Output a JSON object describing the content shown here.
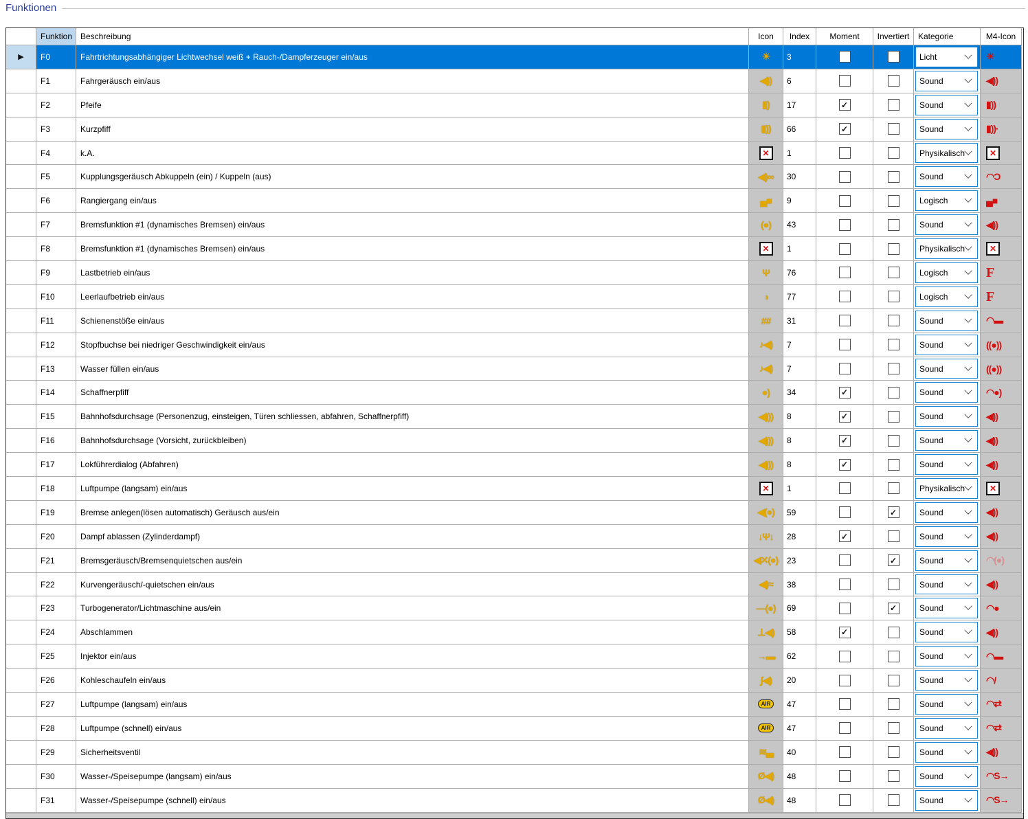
{
  "title": "Funktionen",
  "colors": {
    "selection_blue": "#0078d7",
    "selector_highlight": "#c3dcf0",
    "header_funktion_bg": "#bdd8ee",
    "icon_column_gray": "#c6c6c6",
    "dropdown_border": "#1583d5",
    "title_blue": "#2b3f9e",
    "icon_yellow": "#e3a800",
    "m4_red": "#d31111"
  },
  "table": {
    "columns": [
      {
        "key": "funktion",
        "label": "Funktion"
      },
      {
        "key": "beschreibung",
        "label": "Beschreibung"
      },
      {
        "key": "icon",
        "label": "Icon"
      },
      {
        "key": "index",
        "label": "Index"
      },
      {
        "key": "moment",
        "label": "Moment"
      },
      {
        "key": "invertiert",
        "label": "Invertiert"
      },
      {
        "key": "kategorie",
        "label": "Kategorie"
      },
      {
        "key": "m4",
        "label": "M4-Icon"
      }
    ],
    "rows": [
      {
        "funktion": "F0",
        "beschreibung": "Fahrtrichtungsabhängiger Lichtwechsel weiß + Rauch-/Dampferzeuger ein/aus",
        "icon": {
          "name": "light-sun-icon",
          "glyph": "☀",
          "kind": "yellow"
        },
        "index": "3",
        "moment": false,
        "invertiert": false,
        "kategorie": "Licht",
        "m4": {
          "name": "m4-light-icon",
          "glyph": "☀",
          "kind": "red"
        },
        "selected": true
      },
      {
        "funktion": "F1",
        "beschreibung": "Fahrgeräusch ein/aus",
        "icon": {
          "name": "speaker-waves-icon",
          "glyph": "◀))",
          "kind": "yellow"
        },
        "index": "6",
        "moment": false,
        "invertiert": false,
        "kategorie": "Sound",
        "m4": {
          "name": "m4-speaker-icon",
          "glyph": "◀))",
          "kind": "red"
        },
        "selected": false
      },
      {
        "funktion": "F2",
        "beschreibung": "Pfeife",
        "icon": {
          "name": "whistle-icon",
          "glyph": "▮)",
          "kind": "yellow"
        },
        "index": "17",
        "moment": true,
        "invertiert": false,
        "kategorie": "Sound",
        "m4": {
          "name": "m4-whistle-icon",
          "glyph": "▮))",
          "kind": "red"
        },
        "selected": false
      },
      {
        "funktion": "F3",
        "beschreibung": "Kurzpfiff",
        "icon": {
          "name": "short-whistle-icon",
          "glyph": "▮))",
          "kind": "yellow"
        },
        "index": "66",
        "moment": true,
        "invertiert": false,
        "kategorie": "Sound",
        "m4": {
          "name": "m4-short-whistle-icon",
          "glyph": "▮))·",
          "kind": "red"
        },
        "selected": false
      },
      {
        "funktion": "F4",
        "beschreibung": "k.A.",
        "icon": {
          "name": "not-assigned-x-icon",
          "glyph": "✕",
          "kind": "xbox"
        },
        "index": "1",
        "moment": false,
        "invertiert": false,
        "kategorie": "Physikalisch",
        "m4": {
          "name": "m4-x-icon",
          "glyph": "✕",
          "kind": "xbox"
        },
        "selected": false
      },
      {
        "funktion": "F5",
        "beschreibung": "Kupplungsgeräusch Abkuppeln (ein) / Kuppeln (aus)",
        "icon": {
          "name": "coupler-sound-icon",
          "glyph": "◀)∞",
          "kind": "yellow"
        },
        "index": "30",
        "moment": false,
        "invertiert": false,
        "kategorie": "Sound",
        "m4": {
          "name": "m4-coupler-waves-icon",
          "glyph": "◠Ɔ",
          "kind": "red"
        },
        "selected": false
      },
      {
        "funktion": "F6",
        "beschreibung": "Rangiergang ein/aus",
        "icon": {
          "name": "shunting-loco-icon",
          "glyph": "▄■",
          "kind": "yellow"
        },
        "index": "9",
        "moment": false,
        "invertiert": false,
        "kategorie": "Logisch",
        "m4": {
          "name": "m4-shunting-loco-icon",
          "glyph": "▄■",
          "kind": "red"
        },
        "selected": false
      },
      {
        "funktion": "F7",
        "beschreibung": "Bremsfunktion #1 (dynamisches Bremsen) ein/aus",
        "icon": {
          "name": "dynamic-brake-sound-icon",
          "glyph": "(●)",
          "kind": "yellow"
        },
        "index": "43",
        "moment": false,
        "invertiert": false,
        "kategorie": "Sound",
        "m4": {
          "name": "m4-speaker-icon",
          "glyph": "◀))",
          "kind": "red"
        },
        "selected": false
      },
      {
        "funktion": "F8",
        "beschreibung": "Bremsfunktion #1 (dynamisches Bremsen) ein/aus",
        "icon": {
          "name": "not-assigned-x-icon",
          "glyph": "✕",
          "kind": "xbox"
        },
        "index": "1",
        "moment": false,
        "invertiert": false,
        "kategorie": "Physikalisch",
        "m4": {
          "name": "m4-x-icon",
          "glyph": "✕",
          "kind": "xbox"
        },
        "selected": false
      },
      {
        "funktion": "F9",
        "beschreibung": "Lastbetrieb ein/aus",
        "icon": {
          "name": "load-operation-icon",
          "glyph": "Ψ",
          "kind": "yellow"
        },
        "index": "76",
        "moment": false,
        "invertiert": false,
        "kategorie": "Logisch",
        "m4": {
          "name": "m4-logic-f-icon",
          "glyph": "F",
          "kind": "fletter"
        },
        "selected": false
      },
      {
        "funktion": "F10",
        "beschreibung": "Leerlaufbetrieb ein/aus",
        "icon": {
          "name": "idle-gauge-icon",
          "glyph": "◑",
          "kind": "yellow"
        },
        "index": "77",
        "moment": false,
        "invertiert": false,
        "kategorie": "Logisch",
        "m4": {
          "name": "m4-logic-f-icon",
          "glyph": "F",
          "kind": "fletter"
        },
        "selected": false
      },
      {
        "funktion": "F11",
        "beschreibung": "Schienenstöße ein/aus",
        "icon": {
          "name": "rail-joints-icon",
          "glyph": "##",
          "kind": "yellow"
        },
        "index": "31",
        "moment": false,
        "invertiert": false,
        "kategorie": "Sound",
        "m4": {
          "name": "m4-rail-waves-icon",
          "glyph": "◠▬",
          "kind": "red"
        },
        "selected": false
      },
      {
        "funktion": "F12",
        "beschreibung": "Stopfbuchse bei niedriger Geschwindigkeit ein/aus",
        "icon": {
          "name": "gland-sound-icon",
          "glyph": "♪◀)",
          "kind": "yellow"
        },
        "index": "7",
        "moment": false,
        "invertiert": false,
        "kategorie": "Sound",
        "m4": {
          "name": "m4-gland-lock-icon",
          "glyph": "((●))",
          "kind": "red"
        },
        "selected": false
      },
      {
        "funktion": "F13",
        "beschreibung": "Wasser füllen ein/aus",
        "icon": {
          "name": "water-fill-sound-icon",
          "glyph": "♪◀)",
          "kind": "yellow"
        },
        "index": "7",
        "moment": false,
        "invertiert": false,
        "kategorie": "Sound",
        "m4": {
          "name": "m4-gland-lock-icon",
          "glyph": "((●))",
          "kind": "red"
        },
        "selected": false
      },
      {
        "funktion": "F14",
        "beschreibung": "Schaffnerpfiff",
        "icon": {
          "name": "conductor-whistle-icon",
          "glyph": "●)",
          "kind": "yellow"
        },
        "index": "34",
        "moment": true,
        "invertiert": false,
        "kategorie": "Sound",
        "m4": {
          "name": "m4-whistle-waves-icon",
          "glyph": "◠●)",
          "kind": "red"
        },
        "selected": false
      },
      {
        "funktion": "F15",
        "beschreibung": "Bahnhofsdurchsage (Personenzug, einsteigen, Türen schliessen, abfahren, Schaffnerpfiff)",
        "icon": {
          "name": "announcement-horn-icon",
          "glyph": "◀)))",
          "kind": "yellow"
        },
        "index": "8",
        "moment": true,
        "invertiert": false,
        "kategorie": "Sound",
        "m4": {
          "name": "m4-speaker-icon",
          "glyph": "◀))",
          "kind": "red"
        },
        "selected": false
      },
      {
        "funktion": "F16",
        "beschreibung": "Bahnhofsdurchsage (Vorsicht, zurückbleiben)",
        "icon": {
          "name": "announcement-horn-icon",
          "glyph": "◀)))",
          "kind": "yellow"
        },
        "index": "8",
        "moment": true,
        "invertiert": false,
        "kategorie": "Sound",
        "m4": {
          "name": "m4-speaker-icon",
          "glyph": "◀))",
          "kind": "red"
        },
        "selected": false
      },
      {
        "funktion": "F17",
        "beschreibung": "Lokführerdialog (Abfahren)",
        "icon": {
          "name": "announcement-horn-icon",
          "glyph": "◀)))",
          "kind": "yellow"
        },
        "index": "8",
        "moment": true,
        "invertiert": false,
        "kategorie": "Sound",
        "m4": {
          "name": "m4-speaker-icon",
          "glyph": "◀))",
          "kind": "red"
        },
        "selected": false
      },
      {
        "funktion": "F18",
        "beschreibung": "Luftpumpe (langsam) ein/aus",
        "icon": {
          "name": "not-assigned-x-icon",
          "glyph": "✕",
          "kind": "xbox"
        },
        "index": "1",
        "moment": false,
        "invertiert": false,
        "kategorie": "Physikalisch",
        "m4": {
          "name": "m4-x-icon",
          "glyph": "✕",
          "kind": "xbox"
        },
        "selected": false
      },
      {
        "funktion": "F19",
        "beschreibung": "Bremse anlegen(lösen automatisch) Geräusch aus/ein",
        "icon": {
          "name": "brake-sound-icon",
          "glyph": "◀(●)",
          "kind": "yellow"
        },
        "index": "59",
        "moment": false,
        "invertiert": true,
        "kategorie": "Sound",
        "m4": {
          "name": "m4-speaker-icon",
          "glyph": "◀))",
          "kind": "red"
        },
        "selected": false
      },
      {
        "funktion": "F20",
        "beschreibung": "Dampf ablassen (Zylinderdampf)",
        "icon": {
          "name": "cylinder-steam-icon",
          "glyph": "↓Ψ↓",
          "kind": "yellow"
        },
        "index": "28",
        "moment": true,
        "invertiert": false,
        "kategorie": "Sound",
        "m4": {
          "name": "m4-speaker-icon",
          "glyph": "◀))",
          "kind": "red"
        },
        "selected": false
      },
      {
        "funktion": "F21",
        "beschreibung": "Bremsgeräusch/Bremsenquietschen aus/ein",
        "icon": {
          "name": "brake-squeal-mute-icon",
          "glyph": "◀✕(●)",
          "kind": "yellow"
        },
        "index": "23",
        "moment": false,
        "invertiert": true,
        "kategorie": "Sound",
        "m4": {
          "name": "m4-brake-squeal-icon",
          "glyph": "◠(●)",
          "kind": "reddim"
        },
        "selected": false
      },
      {
        "funktion": "F22",
        "beschreibung": "Kurvengeräusch/-quietschen ein/aus",
        "icon": {
          "name": "curve-squeal-icon",
          "glyph": "◀)≈",
          "kind": "yellow"
        },
        "index": "38",
        "moment": false,
        "invertiert": false,
        "kategorie": "Sound",
        "m4": {
          "name": "m4-speaker-icon",
          "glyph": "◀))",
          "kind": "red"
        },
        "selected": false
      },
      {
        "funktion": "F23",
        "beschreibung": "Turbogenerator/Lichtmaschine aus/ein",
        "icon": {
          "name": "turbo-generator-icon",
          "glyph": "—(●)",
          "kind": "yellow"
        },
        "index": "69",
        "moment": false,
        "invertiert": true,
        "kategorie": "Sound",
        "m4": {
          "name": "m4-generator-waves-icon",
          "glyph": "◠●",
          "kind": "red"
        },
        "selected": false
      },
      {
        "funktion": "F24",
        "beschreibung": "Abschlammen",
        "icon": {
          "name": "blowdown-speaker-icon",
          "glyph": "⊥◀)",
          "kind": "yellow"
        },
        "index": "58",
        "moment": true,
        "invertiert": false,
        "kategorie": "Sound",
        "m4": {
          "name": "m4-speaker-icon",
          "glyph": "◀))",
          "kind": "red"
        },
        "selected": false
      },
      {
        "funktion": "F25",
        "beschreibung": "Injektor ein/aus",
        "icon": {
          "name": "injector-icon",
          "glyph": "→▬",
          "kind": "yellow"
        },
        "index": "62",
        "moment": false,
        "invertiert": false,
        "kategorie": "Sound",
        "m4": {
          "name": "m4-injector-waves-icon",
          "glyph": "◠▬",
          "kind": "red"
        },
        "selected": false
      },
      {
        "funktion": "F26",
        "beschreibung": "Kohleschaufeln ein/aus",
        "icon": {
          "name": "coal-shoveling-icon",
          "glyph": "ʃ◀)",
          "kind": "yellow"
        },
        "index": "20",
        "moment": false,
        "invertiert": false,
        "kategorie": "Sound",
        "m4": {
          "name": "m4-shovel-waves-icon",
          "glyph": "◠/",
          "kind": "red"
        },
        "selected": false
      },
      {
        "funktion": "F27",
        "beschreibung": "Luftpumpe (langsam) ein/aus",
        "icon": {
          "name": "air-pump-badge-icon",
          "glyph": "AIR",
          "kind": "pill"
        },
        "index": "47",
        "moment": false,
        "invertiert": false,
        "kategorie": "Sound",
        "m4": {
          "name": "m4-air-pump-waves-icon",
          "glyph": "◠⇄",
          "kind": "red"
        },
        "selected": false
      },
      {
        "funktion": "F28",
        "beschreibung": "Luftpumpe (schnell) ein/aus",
        "icon": {
          "name": "air-pump-badge-icon",
          "glyph": "AIR",
          "kind": "pill"
        },
        "index": "47",
        "moment": false,
        "invertiert": false,
        "kategorie": "Sound",
        "m4": {
          "name": "m4-air-pump-waves-icon",
          "glyph": "◠⇄",
          "kind": "red"
        },
        "selected": false
      },
      {
        "funktion": "F29",
        "beschreibung": "Sicherheitsventil",
        "icon": {
          "name": "safety-valve-icon",
          "glyph": "≋▃",
          "kind": "yellow"
        },
        "index": "40",
        "moment": false,
        "invertiert": false,
        "kategorie": "Sound",
        "m4": {
          "name": "m4-speaker-icon",
          "glyph": "◀))",
          "kind": "red"
        },
        "selected": false
      },
      {
        "funktion": "F30",
        "beschreibung": "Wasser-/Speisepumpe (langsam) ein/aus",
        "icon": {
          "name": "water-feed-pump-icon",
          "glyph": "Ø◀)",
          "kind": "yellow"
        },
        "index": "48",
        "moment": false,
        "invertiert": false,
        "kategorie": "Sound",
        "m4": {
          "name": "m4-pump-waves-icon",
          "glyph": "◠S→",
          "kind": "red"
        },
        "selected": false
      },
      {
        "funktion": "F31",
        "beschreibung": "Wasser-/Speisepumpe (schnell) ein/aus",
        "icon": {
          "name": "water-feed-pump-icon",
          "glyph": "Ø◀)",
          "kind": "yellow"
        },
        "index": "48",
        "moment": false,
        "invertiert": false,
        "kategorie": "Sound",
        "m4": {
          "name": "m4-pump-waves-icon",
          "glyph": "◠S→",
          "kind": "red"
        },
        "selected": false
      }
    ]
  }
}
